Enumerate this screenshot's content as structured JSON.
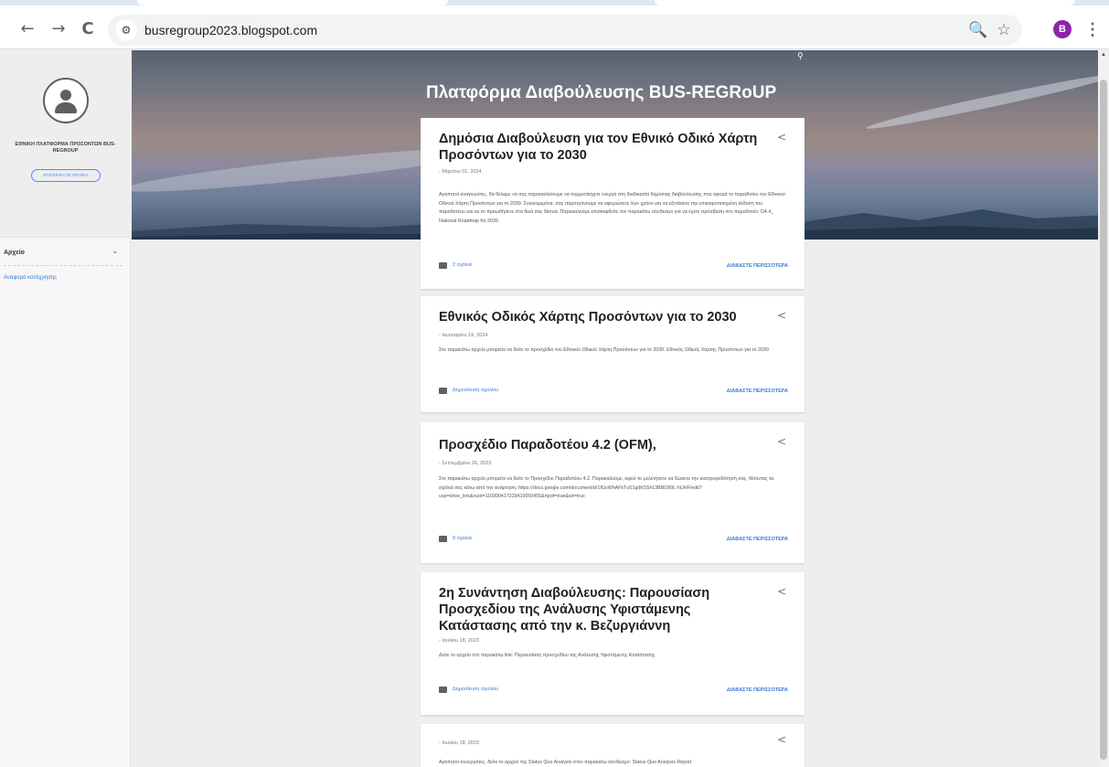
{
  "browser": {
    "url": "busregroup2023.blogspot.com",
    "back_icon": "←",
    "forward_icon": "→",
    "reload_icon": "C",
    "site_info_icon": "⚙",
    "zoom_icon": "🔍",
    "bookmark_icon": "☆",
    "profile_initial": "B",
    "menu_icon": "⋮"
  },
  "sidebar": {
    "profile_name": "ΕΘΝΙΚΗ ΠΛΑΤΦΟΡΜΑ ΠΡΟΣΟΝΤΩΝ BUS-REGROUP",
    "profile_button": "ΕΠΙΣΚΕΨΗ ΣΕ ΠΡΟΦΙΛ",
    "archive_label": "Αρχείο",
    "archive_chevron": "⌄",
    "report_link": "Αναφορά κατάχρησης"
  },
  "header": {
    "blog_title": "Πλατφόρμα Διαβούλευσης BUS-REGRoUP",
    "search_icon": "⚲"
  },
  "posts": [
    {
      "title": "Δημόσια Διαβούλευση για τον Εθνικό Οδικό Χάρτη Προσόντων για το 2030",
      "date": "- Μαρτίου 01, 2024",
      "snippet": "Αγαπητοί αναγνώστες, θα θέλαμε να σας παρακαλέσουμε να συμμετάσχετε ενεργά στη διαδικασία δημόσιας διαβούλευσης που αφορά το παραδοτέο του Εθνικού Οδικού Χάρτη Προσόντων για το 2030. Συγκεκριμένα, σας παροτρύνουμε να αφιερώσετε λίγο χρόνο για να εξετάσετε την επικαιροποιημένη έκδοση του παραδοτέου και να το προωθήσετε στα δικά σας δίκτυα. Παρακαλούμε επισκεφθείτε τον παρακάτω σύνδεσμο για να έχετε πρόσβαση στο παραδοτέο: D4.4_ National Roadmap for 2030",
      "comments": "2 σχόλια",
      "read_more": "ΔΙΑΒΑΣΤΕ ΠΕΡΙΣΣΟΤΕΡΑ"
    },
    {
      "title": "Εθνικός Οδικός Χάρτης Προσόντων για το 2030",
      "date": "- Ιανουαρίου 19, 2024",
      "snippet": "Στο παρακάτω αρχείο μπορείτε να δείτε το προσχέδιο του Εθνικού Οδικού Χάρτη Προσόντων για το 2030. Εθνικός Οδικός Χάρτης Προσόντων για το 2030",
      "comments": "Δημοσίευση σχολίου",
      "read_more": "ΔΙΑΒΑΣΤΕ ΠΕΡΙΣΣΟΤΕΡΑ"
    },
    {
      "title": "Προσχέδιο Παραδοτέου 4.2 (OFM),",
      "date": "- Σεπτεμβρίου 26, 2023",
      "snippet": "Στο παρακάτω αρχείο μπορείτε να δείτε το Προσχέδιο Παραδοτέου 4.2. Παρακαλούμε, αφού το μελετήσετε να δώσετε την ανατροφοδότησή σας, θέτοντας τα σχόλιά σας κάτω από την ανάρτηση. https://docs.google.com/document/d/1fGvWhAFkTvS1gdK5Sh13BBO99L-hUHF/edit?usp=drive_link&ouid=116990417229410050455&rtpof=true&sd=true",
      "comments": "8 σχόλια",
      "read_more": "ΔΙΑΒΑΣΤΕ ΠΕΡΙΣΣΟΤΕΡΑ"
    },
    {
      "title": "2η Συνάντηση Διαβούλευσης: Παρουσίαση Προσχεδίου της Ανάλυσης Υφιστάμενης Κατάστασης από την κ. Βεζυργιάννη",
      "date": "- Ιουλίου 18, 2023",
      "snippet": "Δείτε το αρχείο στο παρακάτω link: Παρουσίαση προσχεδίου της Ανάλυσης Υφιστάμενης Κατάστασης",
      "comments": "Δημοσίευση σχολίου",
      "read_more": "ΔΙΑΒΑΣΤΕ ΠΕΡΙΣΣΟΤΕΡΑ"
    },
    {
      "title": "",
      "date": "- Ιουλίου 18, 2023",
      "snippet": "Αγαπητοί συνεργάτες, δείτε το αρχείο της Status Quo Analysis στον παρακάτω σύνδεσμο: Status Quo Analysis Report"
    }
  ],
  "share_icon": "<",
  "scrollbar": {
    "up_icon": "▲"
  }
}
